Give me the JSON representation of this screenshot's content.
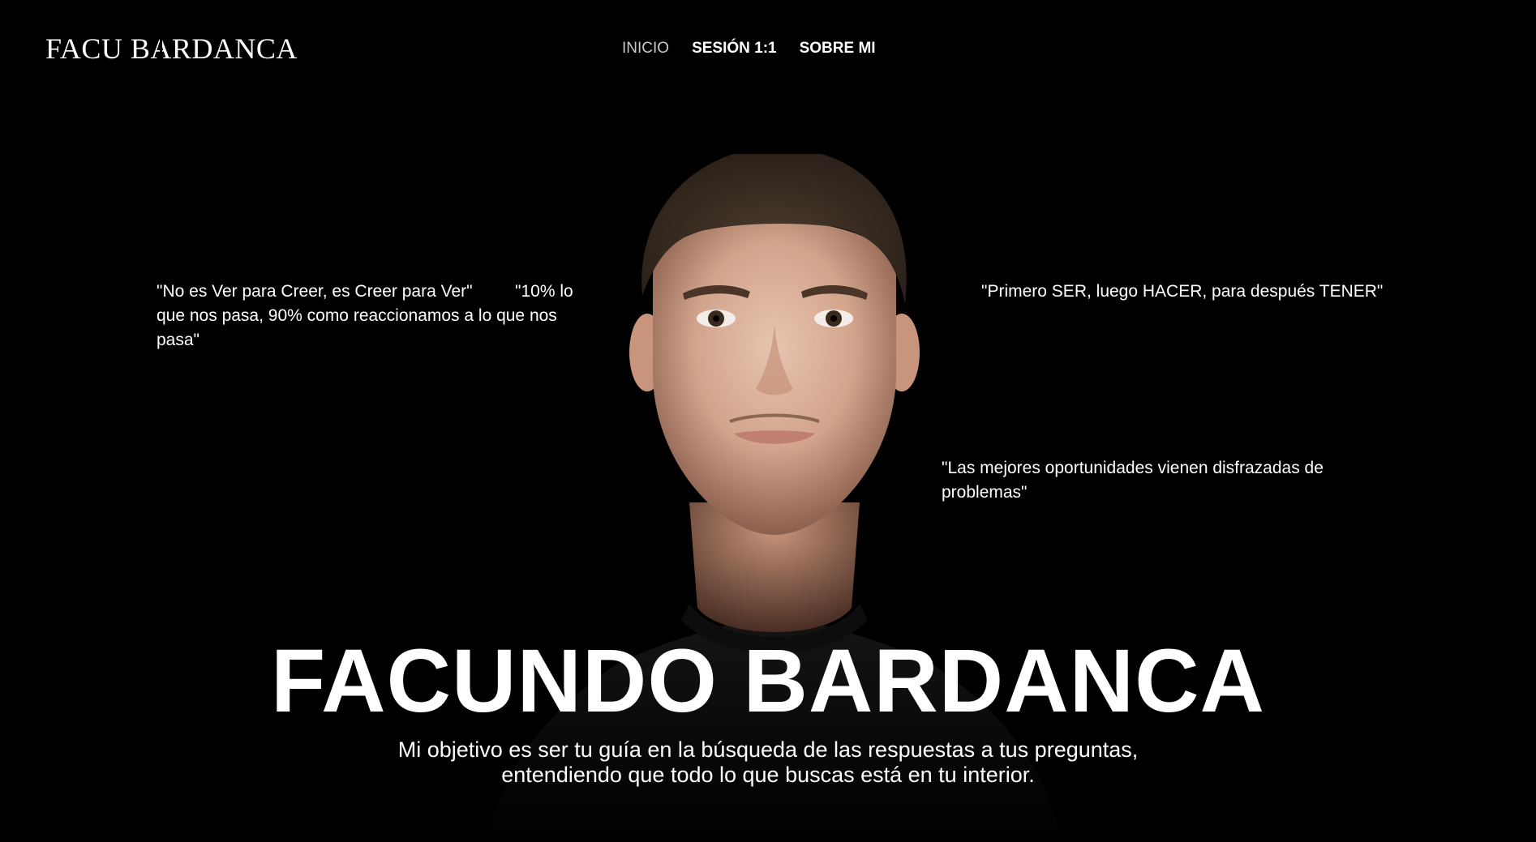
{
  "header": {
    "logo_text_1": "FACU B",
    "logo_text_2": "A",
    "logo_text_3": "RDANCA",
    "nav": [
      {
        "label": "INICIO",
        "active": true
      },
      {
        "label": "SESIÓN 1:1",
        "active": false
      },
      {
        "label": "SOBRE MI",
        "active": false
      }
    ]
  },
  "quotes": {
    "left_1": "\"No es Ver para Creer, es Creer para Ver\"",
    "left_2": "\"10% lo que nos pasa, 90% como reaccionamos a lo que nos pasa\"",
    "right_1": "\"Primero SER, luego HACER, para después TENER\"",
    "right_2": "\"Las mejores oportunidades vienen disfrazadas de problemas\""
  },
  "hero": {
    "title": "FACUNDO BARDANCA",
    "subtitle": "Mi objetivo es ser tu guía en la búsqueda de las respuestas a tus preguntas, entendiendo que todo lo que buscas está en tu interior."
  },
  "colors": {
    "background": "#000000",
    "text": "#ffffff",
    "nav_active": "#c9c9c9"
  }
}
